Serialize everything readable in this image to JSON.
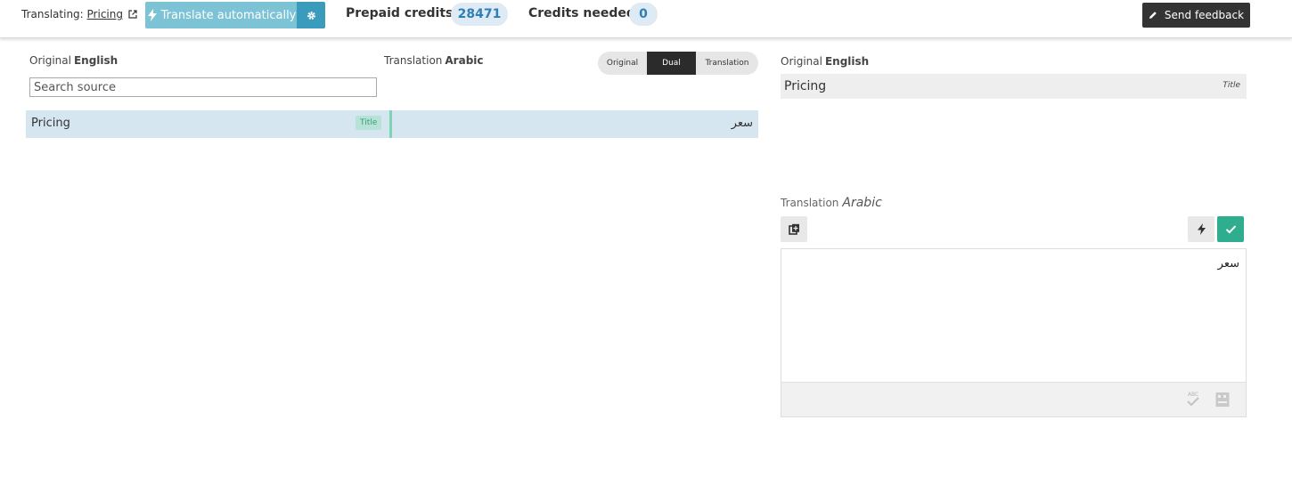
{
  "topbar": {
    "translating_label": "Translating:",
    "translating_link": "Pricing",
    "auto_translate_label": "Translate automatically",
    "prepaid_label": "Prepaid credits:",
    "prepaid_value": "28471",
    "needed_label": "Credits needed",
    "needed_value": "0",
    "feedback_label": "Send feedback"
  },
  "left": {
    "original_label": "Original",
    "original_lang": "English",
    "translation_label": "Translation",
    "translation_lang": "Arabic",
    "search_placeholder": "Search source",
    "view_modes": [
      "Original",
      "Dual",
      "Translation"
    ],
    "active_view_mode": "Dual",
    "rows": [
      {
        "source": "Pricing",
        "tag": "Title",
        "translation": "سعر"
      }
    ]
  },
  "right": {
    "original_label": "Original",
    "original_lang": "English",
    "source_text": "Pricing",
    "source_type": "Title",
    "translation_label": "Translation",
    "translation_lang": "Arabic",
    "translation_text": "سعر",
    "spellcheck_abbr": "ABC"
  },
  "colors": {
    "accent_blue": "#3b9bbd",
    "auto_button": "#7cc3d6",
    "confirm_green": "#2fae8f",
    "row_highlight": "#d6e6f1",
    "credit_pill": "#deeaf4"
  },
  "icons": {
    "external_link": "external-link-icon",
    "bolt": "bolt-icon",
    "gear": "gear-icon",
    "pencil": "pencil-icon",
    "copy": "copy-source-icon",
    "check": "check-icon",
    "spellcheck": "spellcheck-icon",
    "keyboard": "keyboard-icon"
  }
}
